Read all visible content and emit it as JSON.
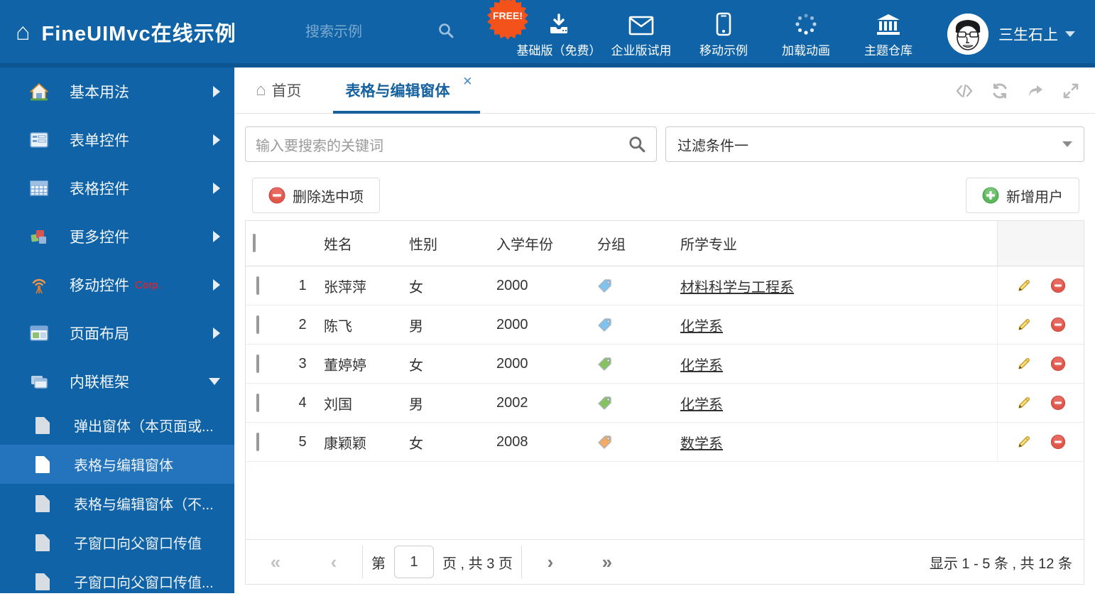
{
  "header": {
    "title": "FineUIMvc在线示例",
    "search_placeholder": "搜索示例",
    "free_badge": "FREE!",
    "nav_items": [
      {
        "label": "基础版（免费）",
        "icon": "download-icon"
      },
      {
        "label": "企业版试用",
        "icon": "envelope-icon"
      },
      {
        "label": "移动示例",
        "icon": "phone-icon"
      },
      {
        "label": "加载动画",
        "icon": "spinner-icon"
      },
      {
        "label": "主题仓库",
        "icon": "bank-icon"
      }
    ],
    "user_name": "三生石上"
  },
  "sidebar": {
    "items": [
      {
        "label": "基本用法"
      },
      {
        "label": "表单控件"
      },
      {
        "label": "表格控件"
      },
      {
        "label": "更多控件"
      },
      {
        "label": "移动控件",
        "suffix": "Corp."
      },
      {
        "label": "页面布局"
      },
      {
        "label": "内联框架"
      }
    ],
    "subitems": [
      {
        "label": "弹出窗体（本页面或..."
      },
      {
        "label": "表格与编辑窗体"
      },
      {
        "label": "表格与编辑窗体（不..."
      },
      {
        "label": "子窗口向父窗口传值"
      },
      {
        "label": "子窗口向父窗口传值..."
      }
    ]
  },
  "tabs": {
    "home": "首页",
    "active": "表格与编辑窗体",
    "close_glyph": "✕"
  },
  "filters": {
    "search_placeholder": "输入要搜索的关键词",
    "filter_value": "过滤条件一"
  },
  "toolbar": {
    "delete_label": "删除选中项",
    "add_label": "新增用户"
  },
  "grid": {
    "columns": {
      "name": "姓名",
      "gender": "性别",
      "year": "入学年份",
      "group": "分组",
      "major": "所学专业"
    },
    "rows": [
      {
        "num": "1",
        "name": "张萍萍",
        "gender": "女",
        "year": "2000",
        "tag_color": "blue",
        "major": "材料科学与工程系"
      },
      {
        "num": "2",
        "name": "陈飞",
        "gender": "男",
        "year": "2000",
        "tag_color": "blue",
        "major": "化学系"
      },
      {
        "num": "3",
        "name": "董婷婷",
        "gender": "女",
        "year": "2000",
        "tag_color": "green",
        "major": "化学系"
      },
      {
        "num": "4",
        "name": "刘国",
        "gender": "男",
        "year": "2002",
        "tag_color": "green",
        "major": "化学系"
      },
      {
        "num": "5",
        "name": "康颖颖",
        "gender": "女",
        "year": "2008",
        "tag_color": "orange",
        "major": "数学系"
      }
    ]
  },
  "pagination": {
    "first": "«",
    "prev": "‹",
    "next": "›",
    "last": "»",
    "page_prefix": "第",
    "page_value": "1",
    "page_suffix": "页 , 共 3 页",
    "summary": "显示 1 - 5 条 , 共 12 条"
  },
  "colors": {
    "header_bg": "#0f63a6",
    "active_submenu_bg": "#2374bc",
    "tab_accent": "#17629e",
    "free_badge_bg": "#f4521b",
    "delete_red": "#e2574c",
    "add_green": "#5cb85c",
    "tags": {
      "blue": "#7fc3f0",
      "green": "#86c25d",
      "orange": "#f3ab64"
    }
  }
}
